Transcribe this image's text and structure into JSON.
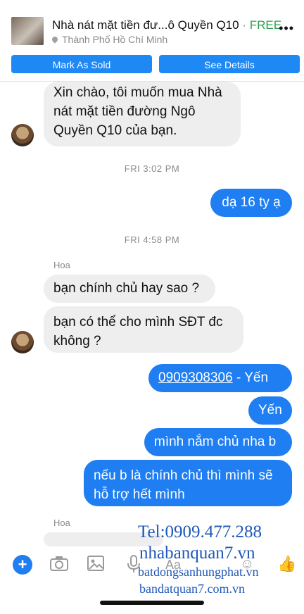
{
  "header": {
    "title": "Nhà nát mặt tiền đư...ô Quyền Q10",
    "separator": " · ",
    "price": "FREE",
    "location": "Thành Phố Hồ Chí Minh",
    "more_icon": "more-dots-icon",
    "location_icon": "pin-icon",
    "mark_sold_label": "Mark As Sold",
    "see_details_label": "See Details"
  },
  "messages": [
    {
      "dir": "in",
      "text": "Xin chào, tôi muốn mua Nhà nát mặt tiền đường Ngô Quyền Q10 của bạn."
    },
    {
      "dir": "time",
      "text": "FRI 3:02 PM"
    },
    {
      "dir": "out",
      "text": "dạ 16 ty ạ"
    },
    {
      "dir": "time",
      "text": "FRI 4:58 PM"
    },
    {
      "dir": "sender",
      "text": "Hoa"
    },
    {
      "dir": "in",
      "text": "bạn chính chủ hay sao ?"
    },
    {
      "dir": "in",
      "text": "bạn có thể cho mình SĐT đc không ?"
    },
    {
      "dir": "out",
      "text_link": "0909308306",
      "text_rest": " - Yến"
    },
    {
      "dir": "out",
      "text": "Yến"
    },
    {
      "dir": "out",
      "text": "mình nắm chủ nha b"
    },
    {
      "dir": "out",
      "text": "nếu b là chính chủ thì mình sẽ hỗ trợ hết mình"
    },
    {
      "dir": "sender",
      "text": "Hoa"
    }
  ],
  "composer": {
    "aa_label": "Aa",
    "icons": [
      "plus-icon",
      "camera-icon",
      "image-icon",
      "microphone-icon",
      "emoji-icon",
      "like-icon"
    ]
  },
  "watermark": {
    "tel": "Tel:0909.477.288",
    "site1": "nhabanquan7.vn",
    "site2": "batdongsanhungphat.vn",
    "site3": "bandatquan7.com.vn"
  },
  "colors": {
    "accent": "#1e7ef2",
    "price": "#2e9e4f",
    "incoming": "#eeeeee",
    "watermark": "#1f57b8"
  }
}
